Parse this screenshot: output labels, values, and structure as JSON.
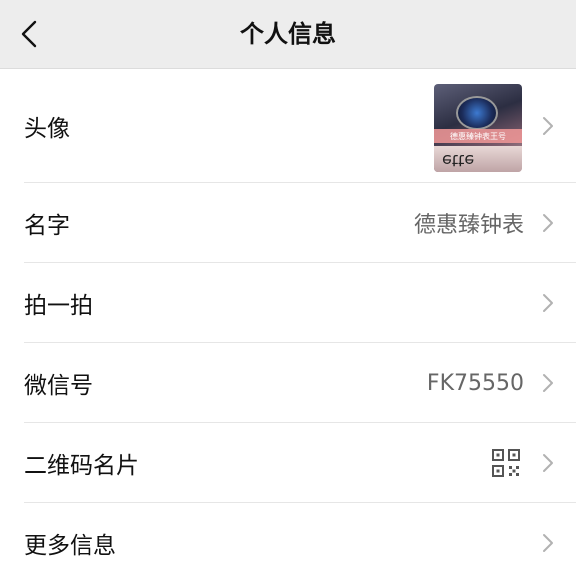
{
  "header": {
    "title": "个人信息"
  },
  "rows": {
    "avatar": {
      "label": "头像",
      "watermark": "德惠臻钟表王号",
      "photo_text": "ette"
    },
    "name": {
      "label": "名字",
      "value": "德惠臻钟表"
    },
    "pat": {
      "label": "拍一拍"
    },
    "wechat_id": {
      "label": "微信号",
      "value": "FK75550"
    },
    "qr_code": {
      "label": "二维码名片"
    },
    "more": {
      "label": "更多信息"
    }
  },
  "icons": {
    "back": "chevron-left-icon",
    "row_arrow": "chevron-right-icon",
    "qr": "qr-code-icon"
  },
  "colors": {
    "nav_bg": "#ededed",
    "value_text": "#666666",
    "chevron": "#b2b2b2"
  }
}
